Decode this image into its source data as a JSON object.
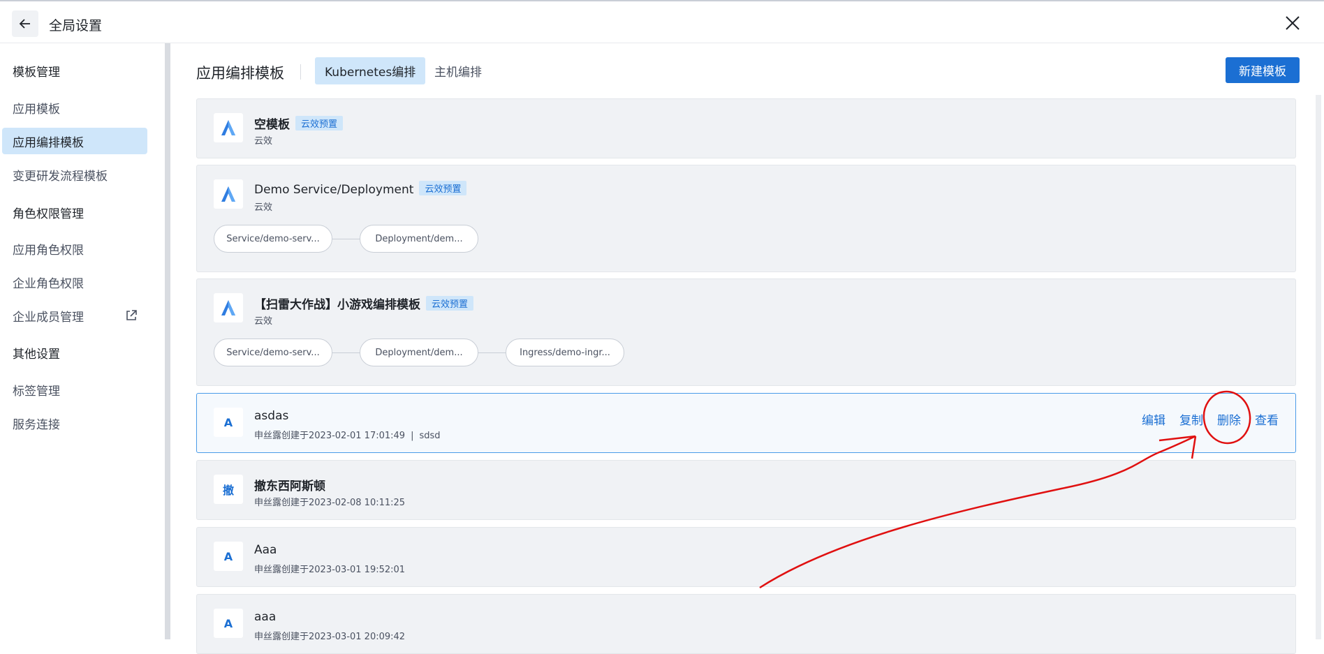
{
  "header": {
    "title": "全局设置",
    "back_icon": "arrow-left-icon",
    "close_icon": "close-icon"
  },
  "sidebar": {
    "groups": [
      {
        "label": "模板管理",
        "items": [
          "应用模板",
          "应用编排模板",
          "变更研发流程模板"
        ]
      },
      {
        "label": "角色权限管理",
        "items": [
          "应用角色权限",
          "企业角色权限",
          "企业成员管理"
        ]
      },
      {
        "label": "其他设置",
        "items": [
          "标签管理",
          "服务连接"
        ]
      }
    ],
    "active_item": "应用编排模板",
    "external_link_icon": "external-link-icon"
  },
  "main": {
    "title": "应用编排模板",
    "tabs": [
      {
        "label": "Kubernetes编排",
        "active": true
      },
      {
        "label": "主机编排",
        "active": false
      }
    ],
    "new_button": "新建模板"
  },
  "templates": [
    {
      "icon_text": "",
      "name": "空模板",
      "badge": "云效预置",
      "subtitle": "云效",
      "nodes": []
    },
    {
      "icon_text": "",
      "name": "Demo Service/Deployment",
      "badge": "云效预置",
      "subtitle": "云效",
      "nodes": [
        "Service/demo-serv...",
        "Deployment/dem..."
      ]
    },
    {
      "icon_text": "",
      "name": "【扫雷大作战】小游戏编排模板",
      "badge": "云效预置",
      "subtitle": "云效",
      "nodes": [
        "Service/demo-serv...",
        "Deployment/dem...",
        "Ingress/demo-ingr..."
      ]
    },
    {
      "icon_text": "A",
      "name": "asdas",
      "creator": "申丝露创建于2023-02-01 17:01:49",
      "sep": "|",
      "desc": "sdsd",
      "actions": [
        "编辑",
        "复制",
        "删除",
        "查看"
      ]
    },
    {
      "icon_text": "撤",
      "name": "撤东西阿斯顿",
      "creator": "申丝露创建于2023-02-08 10:11:25"
    },
    {
      "icon_text": "A",
      "name": "Aaa",
      "creator": "申丝露创建于2023-03-01 19:52:01"
    },
    {
      "icon_text": "A",
      "name": "aaa",
      "creator": "申丝露创建于2023-03-01 20:09:42"
    }
  ],
  "colors": {
    "accent": "#1b6fd3",
    "active_bg": "#cfe6fa",
    "card_bg": "#f0f2f5",
    "annotation": "#e01010"
  }
}
